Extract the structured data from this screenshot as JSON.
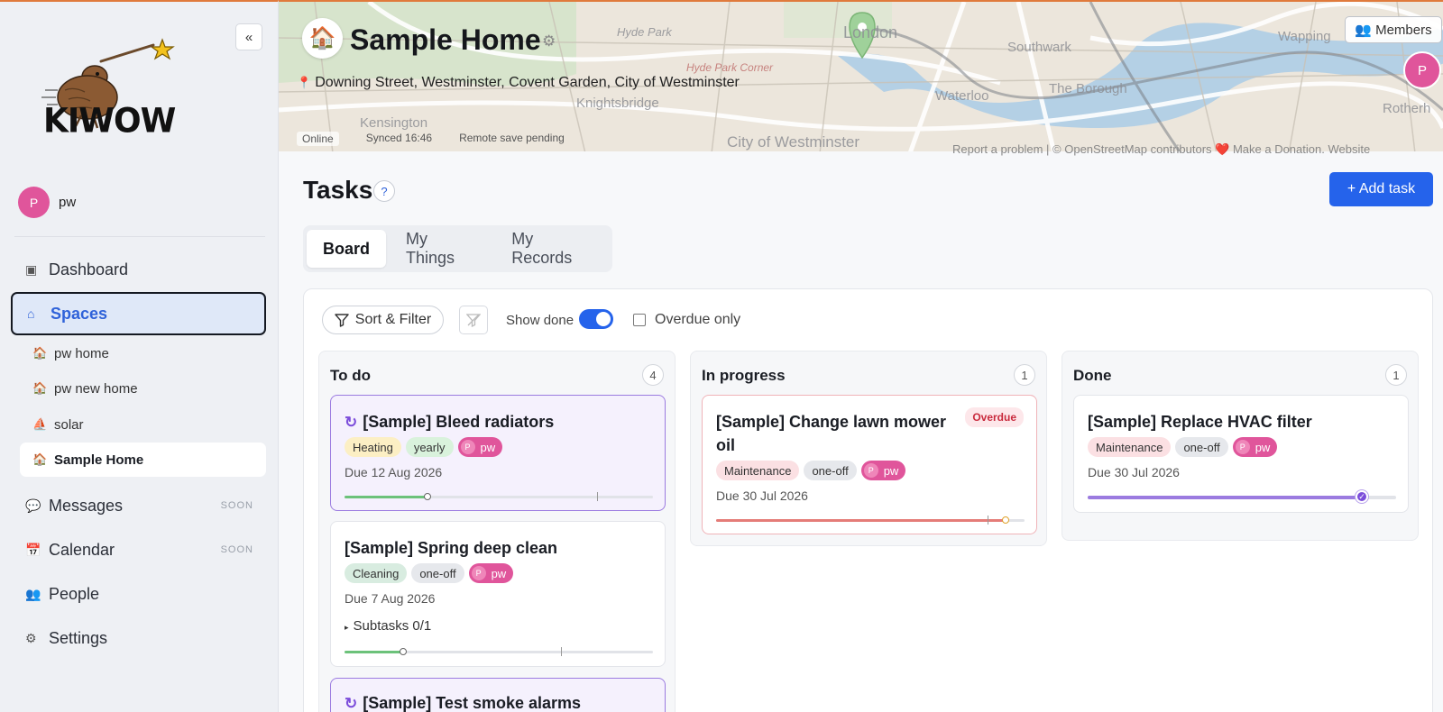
{
  "sidebar": {
    "collapse_label": "«",
    "logo_text": "KIWOW",
    "user": {
      "avatar_initial": "P",
      "name": "pw"
    },
    "nav": {
      "dashboard": {
        "label": "Dashboard",
        "icon": "dashboard-icon"
      },
      "spaces": {
        "label": "Spaces",
        "icon": "home-icon"
      },
      "messages": {
        "label": "Messages",
        "icon": "chat-bubble-icon",
        "badge": "SOON"
      },
      "calendar": {
        "label": "Calendar",
        "icon": "calendar-icon",
        "badge": "SOON"
      },
      "people": {
        "label": "People",
        "icon": "people-icon"
      },
      "settings": {
        "label": "Settings",
        "icon": "gear-icon"
      }
    },
    "spaces": [
      {
        "label": "pw home",
        "icon": "house-icon",
        "selected": false
      },
      {
        "label": "pw new home",
        "icon": "house-icon",
        "selected": false
      },
      {
        "label": "solar",
        "icon": "sailboat-icon",
        "selected": false
      },
      {
        "label": "Sample Home",
        "icon": "house-icon",
        "selected": true
      }
    ]
  },
  "header": {
    "space_title": "Sample Home",
    "address": "Downing Street, Westminster, Covent Garden, City of Westminster",
    "status": {
      "online": "Online",
      "synced": "Synced 16:46",
      "remote": "Remote save pending"
    },
    "members_label": "Members",
    "avatar_initial": "P",
    "map_labels": {
      "hyde_park": "Hyde Park",
      "london": "London",
      "southwark": "Southwark",
      "wapping": "Wapping",
      "hyde_park_corner": "Hyde Park Corner",
      "waterloo": "Waterloo",
      "borough": "The Borough",
      "knightsbridge": "Knightsbridge",
      "kensington": "Kensington",
      "westminster": "City of Westminster",
      "rotherhithe": "Rotherh",
      "credit": "Report a problem | © OpenStreetMap contributors ❤️ Make a Donation. Website"
    }
  },
  "main": {
    "title": "Tasks",
    "help_label": "?",
    "add_task_label": "+ Add task",
    "tabs": [
      {
        "label": "Board",
        "active": true
      },
      {
        "label": "My Things",
        "active": false
      },
      {
        "label": "My Records",
        "active": false
      }
    ],
    "toolbar": {
      "sort_filter_label": "Sort & Filter",
      "show_done_label": "Show done",
      "show_done_on": true,
      "overdue_only_label": "Overdue only",
      "overdue_only_checked": false
    },
    "columns": [
      {
        "title": "To do",
        "count": "4",
        "cards": [
          {
            "title": "[Sample] Bleed radiators",
            "recurring": true,
            "tags": [
              "Heating",
              "yearly"
            ],
            "assignee": "pw",
            "due": "Due 12 Aug 2026",
            "progress": 0.27
          },
          {
            "title": "[Sample] Spring deep clean",
            "recurring": false,
            "tags": [
              "Cleaning",
              "one-off"
            ],
            "assignee": "pw",
            "due": "Due 7 Aug 2026",
            "subtasks": "Subtasks 0/1",
            "progress": 0.19
          },
          {
            "title": "[Sample] Test smoke alarms",
            "recurring": true
          }
        ]
      },
      {
        "title": "In progress",
        "count": "1",
        "cards": [
          {
            "title_line1": "[Sample] Change lawn mower",
            "title_line2": "oil",
            "overdue_label": "Overdue",
            "tags": [
              "Maintenance",
              "one-off"
            ],
            "assignee": "pw",
            "due": "Due 30 Jul 2026",
            "progress": 0.94
          }
        ]
      },
      {
        "title": "Done",
        "count": "1",
        "cards": [
          {
            "title": "[Sample] Replace HVAC filter",
            "tags": [
              "Maintenance",
              "one-off"
            ],
            "assignee": "pw",
            "due": "Due 30 Jul 2026",
            "progress": 0.89
          }
        ]
      }
    ]
  },
  "colors": {
    "accent": "#2563eb",
    "avatar": "#e0559b",
    "recurring": "#7c4ddb",
    "overdue": "#c92a3d",
    "tag_heating": "#fcefc4",
    "tag_yearly": "#d9f2dc",
    "tag_cleaning": "#d8ece0",
    "tag_maintenance": "#fbe0e3",
    "tag_oneoff": "#e6e8ec"
  }
}
